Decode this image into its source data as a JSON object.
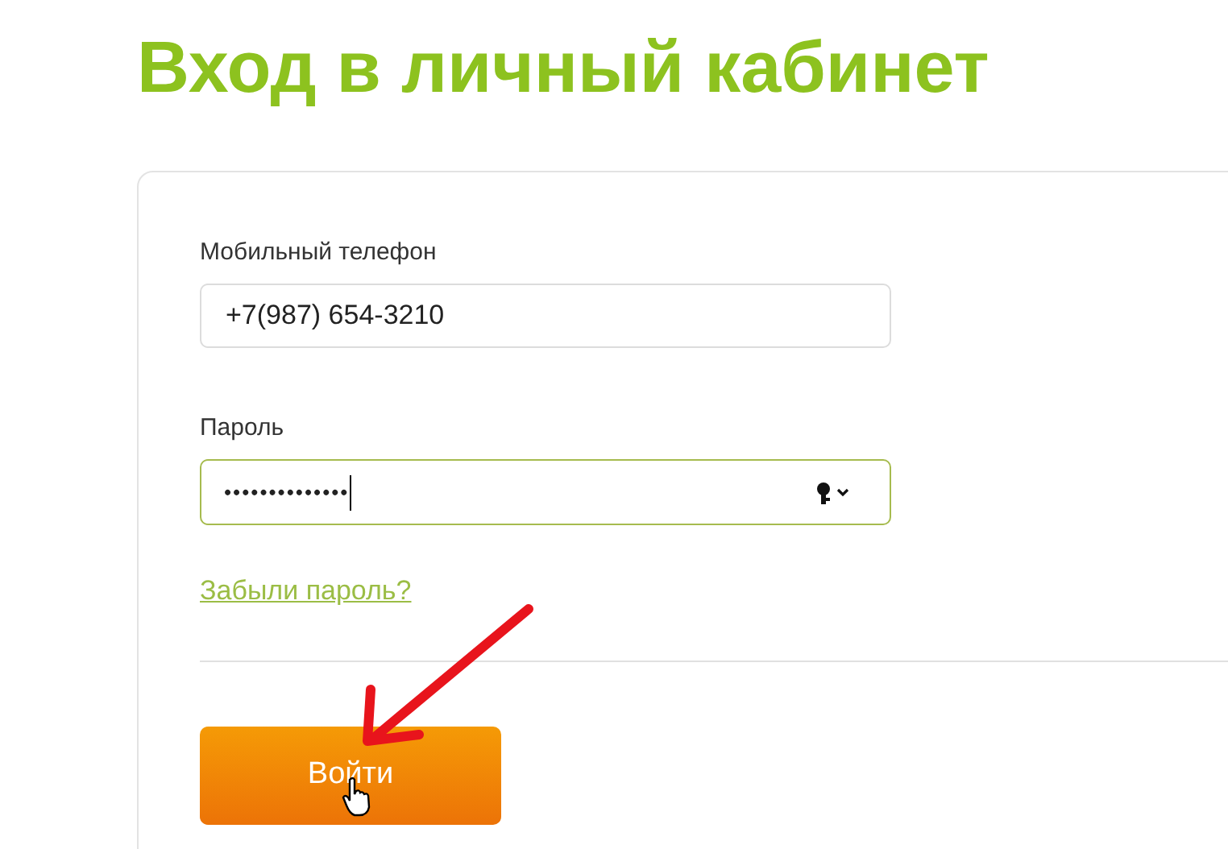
{
  "title": "Вход в личный кабинет",
  "phone": {
    "label": "Мобильный телефон",
    "value": "+7(987) 654-3210"
  },
  "password": {
    "label": "Пароль",
    "value": "••••••••••••••",
    "focused": true
  },
  "forgot_link": "Забыли пароль?",
  "submit_button": "Войти"
}
